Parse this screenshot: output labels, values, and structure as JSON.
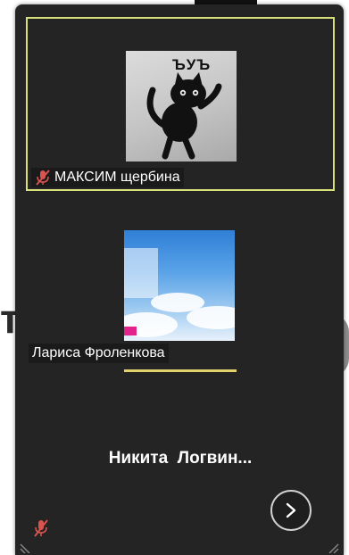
{
  "panel": {
    "participants": [
      {
        "name": "МАКСИМ щербина",
        "avatar_caption": "ЪУЪ",
        "muted": true,
        "active_speaker": true
      },
      {
        "name": "Лариса Фроленкова",
        "muted": false,
        "active_speaker": false
      },
      {
        "name": "Никита  Логвин...",
        "muted": true,
        "active_speaker": false
      }
    ],
    "next_page_icon": "chevron-right-icon"
  },
  "colors": {
    "panel_bg": "#242424",
    "active_border": "#d8e07a",
    "muted_icon": "#d9534f",
    "talk_indicator": "#e3d16b"
  }
}
